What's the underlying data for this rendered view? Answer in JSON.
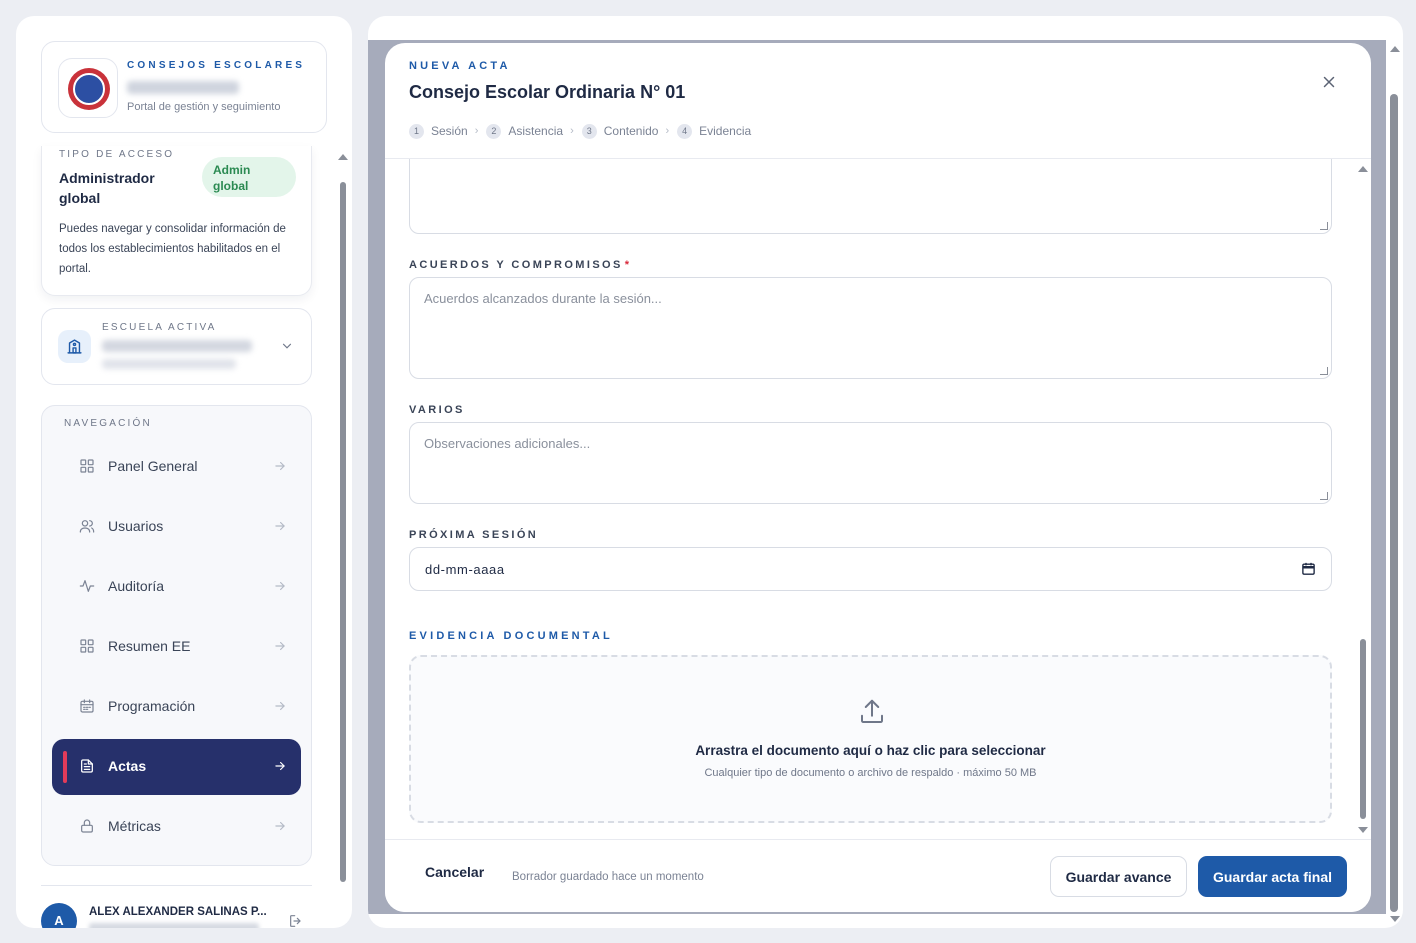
{
  "brand": {
    "kicker": "CONSEJOS ESCOLARES",
    "subtitle": "Portal de gestión y seguimiento"
  },
  "access": {
    "kicker": "TIPO DE ACCESO",
    "role": "Administrador global",
    "badge": "Admin global",
    "description": "Puedes navegar y consolidar información de todos los establecimientos habilitados en el portal."
  },
  "school": {
    "kicker": "ESCUELA ACTIVA"
  },
  "nav": {
    "kicker": "NAVEGACIÓN",
    "items": [
      {
        "label": "Panel General",
        "icon": "grid-icon"
      },
      {
        "label": "Usuarios",
        "icon": "users-icon"
      },
      {
        "label": "Auditoría",
        "icon": "activity-icon"
      },
      {
        "label": "Resumen EE",
        "icon": "grid-icon"
      },
      {
        "label": "Programación",
        "icon": "calendar-icon"
      },
      {
        "label": "Actas",
        "icon": "document-icon",
        "active": true
      },
      {
        "label": "Métricas",
        "icon": "lock-icon"
      }
    ]
  },
  "user": {
    "initial": "A",
    "name": "ALEX ALEXANDER SALINAS P..."
  },
  "modal": {
    "kicker": "NUEVA ACTA",
    "title": "Consejo Escolar Ordinaria N° 01",
    "steps": [
      {
        "num": "1",
        "label": "Sesión"
      },
      {
        "num": "2",
        "label": "Asistencia"
      },
      {
        "num": "3",
        "label": "Contenido"
      },
      {
        "num": "4",
        "label": "Evidencia"
      }
    ],
    "fields": {
      "agreements_label": "ACUERDOS Y COMPROMISOS",
      "required_mark": "*",
      "agreements_placeholder": "Acuerdos alcanzados durante la sesión...",
      "misc_label": "VARIOS",
      "misc_placeholder": "Observaciones adicionales...",
      "next_session_label": "PRÓXIMA SESIÓN",
      "next_session_value": "dd-mm-aaaa"
    },
    "evidence": {
      "kicker": "EVIDENCIA DOCUMENTAL",
      "drop_title": "Arrastra el documento aquí o haz clic para seleccionar",
      "drop_hint": "Cualquier tipo de documento o archivo de respaldo · máximo 50 MB"
    },
    "footer": {
      "cancel": "Cancelar",
      "draft_note": "Borrador guardado hace un momento",
      "save": "Guardar avance",
      "final": "Guardar acta final"
    }
  },
  "colors": {
    "accent": "#1e5aa8",
    "nav_active": "#26306b",
    "active_marker": "#e23b5a",
    "badge_bg": "#e3f5ea",
    "badge_text": "#2b8a52"
  }
}
